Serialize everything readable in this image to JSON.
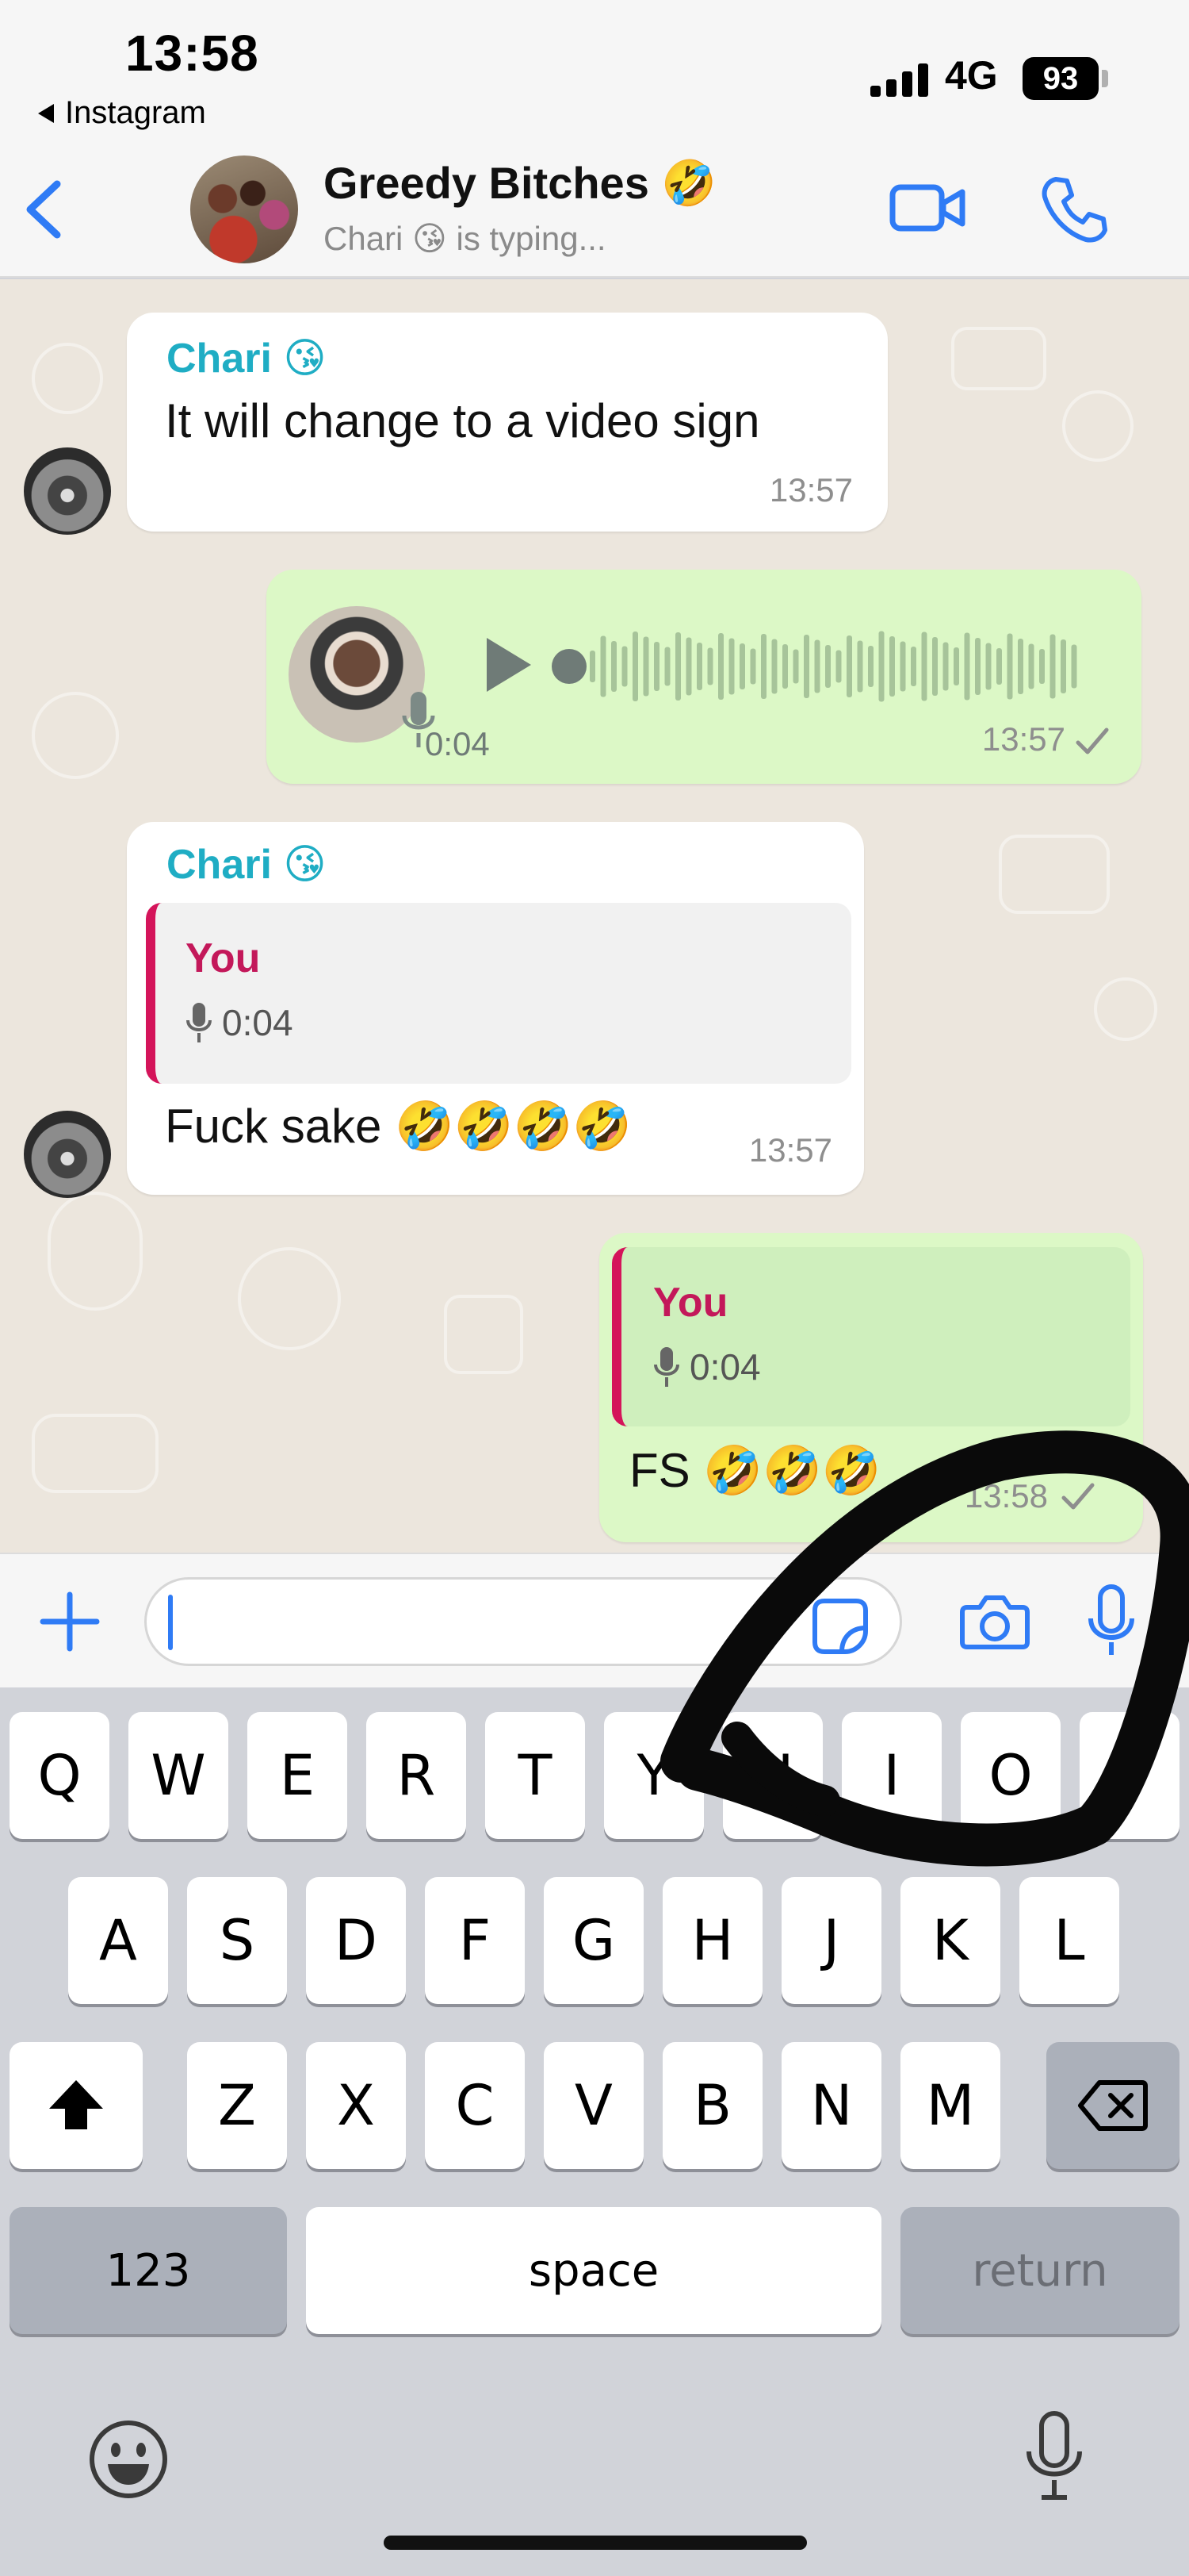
{
  "status_bar": {
    "time": "13:58",
    "back_app": "Instagram",
    "network": "4G",
    "battery": "93"
  },
  "header": {
    "title": "Greedy Bitches 🤣",
    "subtitle": "Chari 😘 is typing..."
  },
  "messages": [
    {
      "type": "incoming_text",
      "sender": "Chari 😘",
      "text": "It will change to a video sign",
      "time": "13:57"
    },
    {
      "type": "outgoing_voice",
      "duration": "0:04",
      "time": "13:57",
      "status": "sent"
    },
    {
      "type": "incoming_reply",
      "sender": "Chari 😘",
      "quoted_name": "You",
      "quoted_voice": "0:04",
      "text": "Fuck sake 🤣🤣🤣🤣",
      "time": "13:57"
    },
    {
      "type": "outgoing_reply",
      "quoted_name": "You",
      "quoted_voice": "0:04",
      "text": "FS 🤣🤣🤣",
      "time": "13:58"
    }
  ],
  "keyboard": {
    "row1": [
      "Q",
      "W",
      "E",
      "R",
      "T",
      "Y",
      "U",
      "I",
      "O",
      "P"
    ],
    "row2": [
      "A",
      "S",
      "D",
      "F",
      "G",
      "H",
      "J",
      "K",
      "L"
    ],
    "row3": [
      "Z",
      "X",
      "C",
      "V",
      "B",
      "N",
      "M"
    ],
    "numbers": "123",
    "space": "space",
    "return": "return"
  },
  "colors": {
    "accent": "#2f7bf5",
    "sender_name": "#1fadc4",
    "quote_name": "#c3185a",
    "outgoing_bubble": "#dcf8c6",
    "chat_background": "#ece6dd"
  },
  "icons": [
    "back-chevron-icon",
    "video-call-icon",
    "phone-icon",
    "play-icon",
    "mic-icon",
    "plus-icon",
    "sticker-icon",
    "camera-icon",
    "shift-icon",
    "backspace-icon",
    "emoji-icon",
    "dictation-icon"
  ]
}
